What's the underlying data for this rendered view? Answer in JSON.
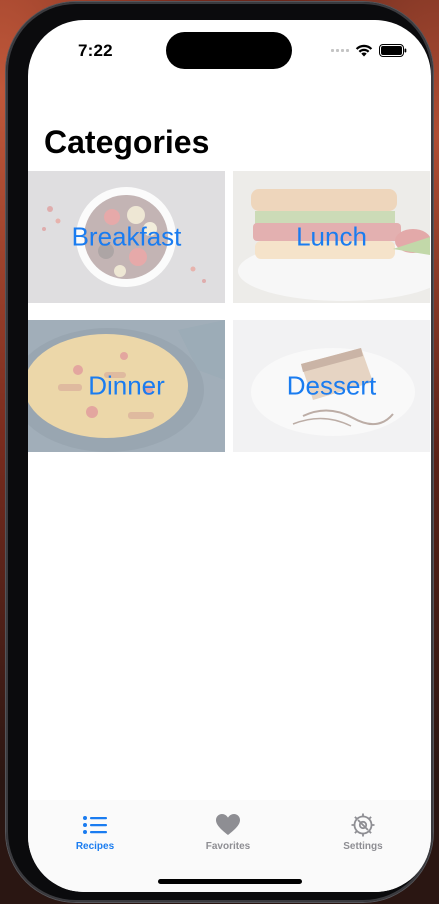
{
  "status_bar": {
    "time": "7:22"
  },
  "page": {
    "title": "Categories"
  },
  "categories": [
    {
      "label": "Breakfast"
    },
    {
      "label": "Lunch"
    },
    {
      "label": "Dinner"
    },
    {
      "label": "Dessert"
    }
  ],
  "tab_bar": {
    "active_color": "#1a7cf0",
    "inactive_color": "#8e8e93",
    "tabs": [
      {
        "label": "Recipes",
        "icon": "list-icon",
        "active": true
      },
      {
        "label": "Favorites",
        "icon": "heart-icon",
        "active": false
      },
      {
        "label": "Settings",
        "icon": "gear-icon",
        "active": false
      }
    ]
  }
}
